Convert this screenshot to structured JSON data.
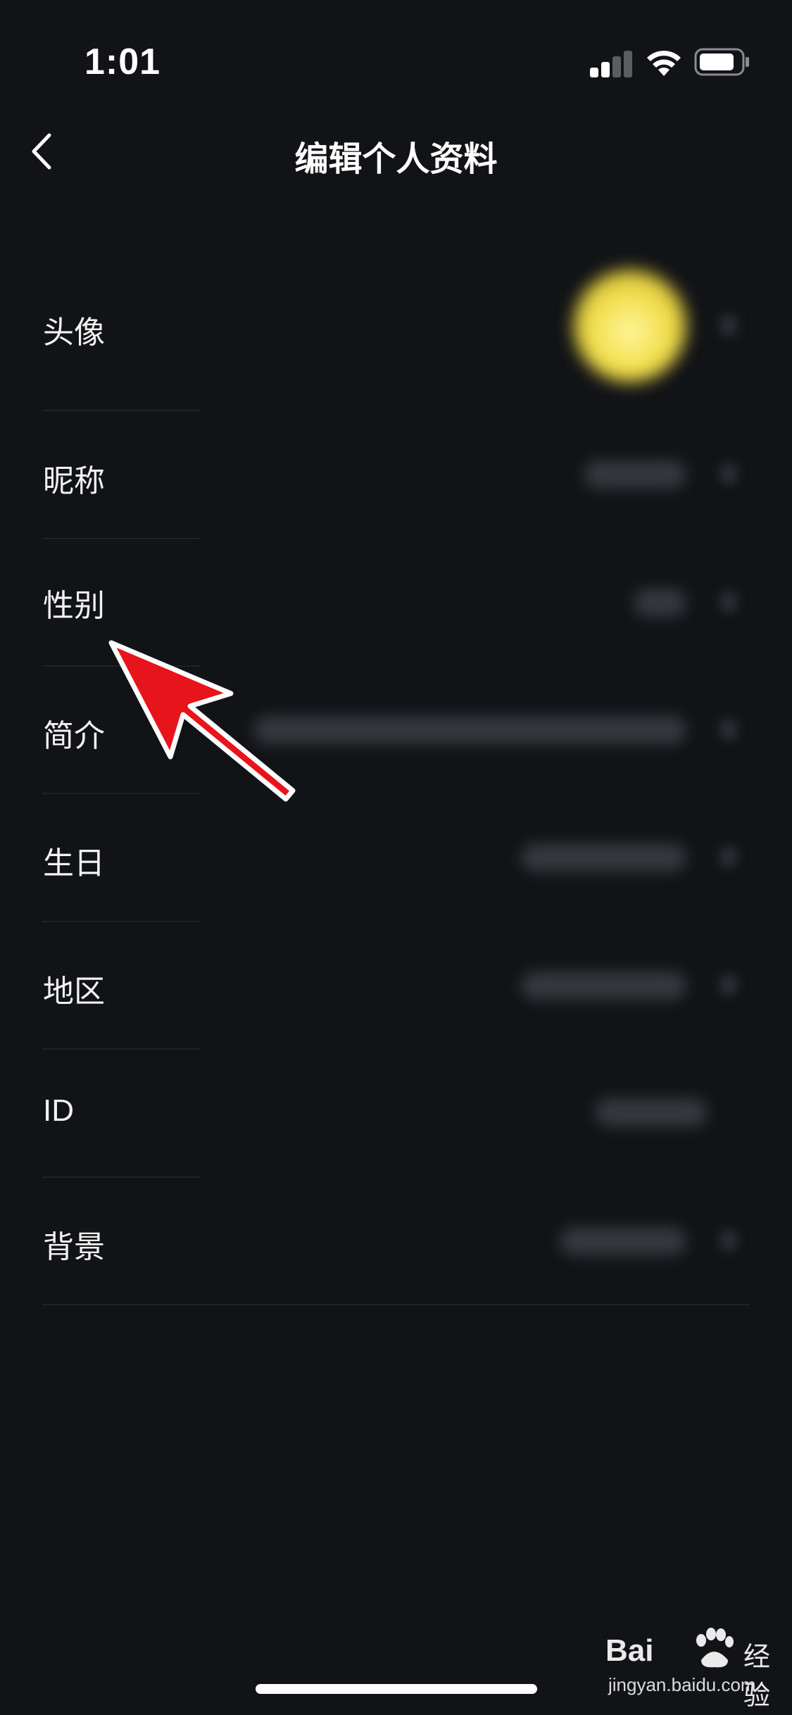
{
  "status_bar": {
    "time": "1:01"
  },
  "nav": {
    "title": "编辑个人资料"
  },
  "rows": [
    {
      "label": "头像"
    },
    {
      "label": "昵称"
    },
    {
      "label": "性别"
    },
    {
      "label": "简介"
    },
    {
      "label": "生日"
    },
    {
      "label": "地区"
    },
    {
      "label": "ID"
    },
    {
      "label": "背景"
    }
  ],
  "watermark": {
    "brand": "Bai",
    "brand_cn": "经验",
    "url": "jingyan.baidu.com"
  },
  "colors": {
    "background": "#121317",
    "text": "#ffffff",
    "annotation": "#e8141c"
  }
}
